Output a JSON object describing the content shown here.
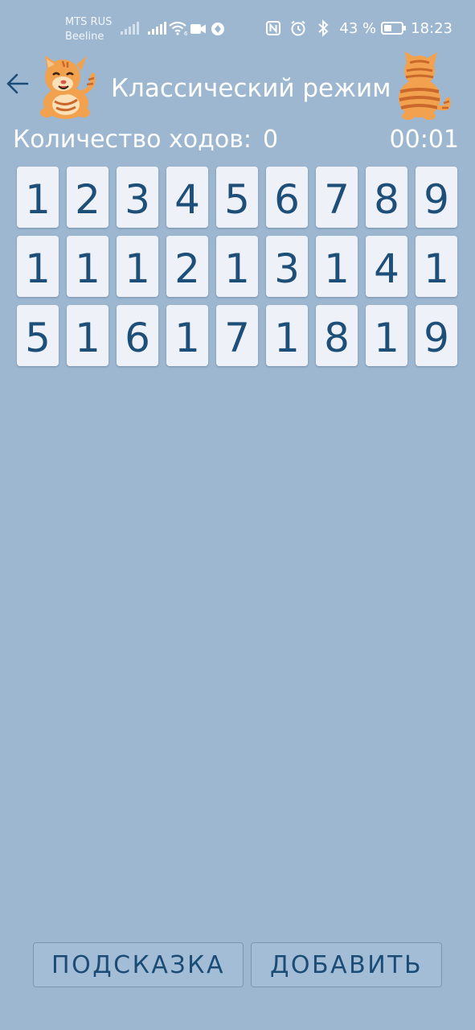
{
  "status_bar": {
    "carrier_1": "MTS RUS",
    "carrier_2": "Beeline",
    "battery_percent": "43 %",
    "battery_level": 0.43,
    "time": "18:23",
    "icons": [
      "signal-icon",
      "signal-icon",
      "wifi-icon",
      "video-call-icon",
      "vpn-icon",
      "nfc-icon",
      "alarm-icon",
      "bluetooth-icon",
      "battery-icon"
    ]
  },
  "header": {
    "back_icon": "arrow-left-icon",
    "title": "Классический режим"
  },
  "stats": {
    "moves_label": "Количество ходов:",
    "moves_count": "0",
    "timer": "00:01"
  },
  "grid": {
    "rows": [
      [
        "1",
        "2",
        "3",
        "4",
        "5",
        "6",
        "7",
        "8",
        "9"
      ],
      [
        "1",
        "1",
        "1",
        "2",
        "1",
        "3",
        "1",
        "4",
        "1"
      ],
      [
        "5",
        "1",
        "6",
        "1",
        "7",
        "1",
        "8",
        "1",
        "9"
      ]
    ]
  },
  "buttons": {
    "hint_label": "ПОДСКАЗКА",
    "add_label": "ДОБАВИТЬ"
  },
  "colors": {
    "background": "#9db7d1",
    "tile": "#eef2f8",
    "digit": "#1e4f78",
    "button_text": "#1b4c76"
  }
}
